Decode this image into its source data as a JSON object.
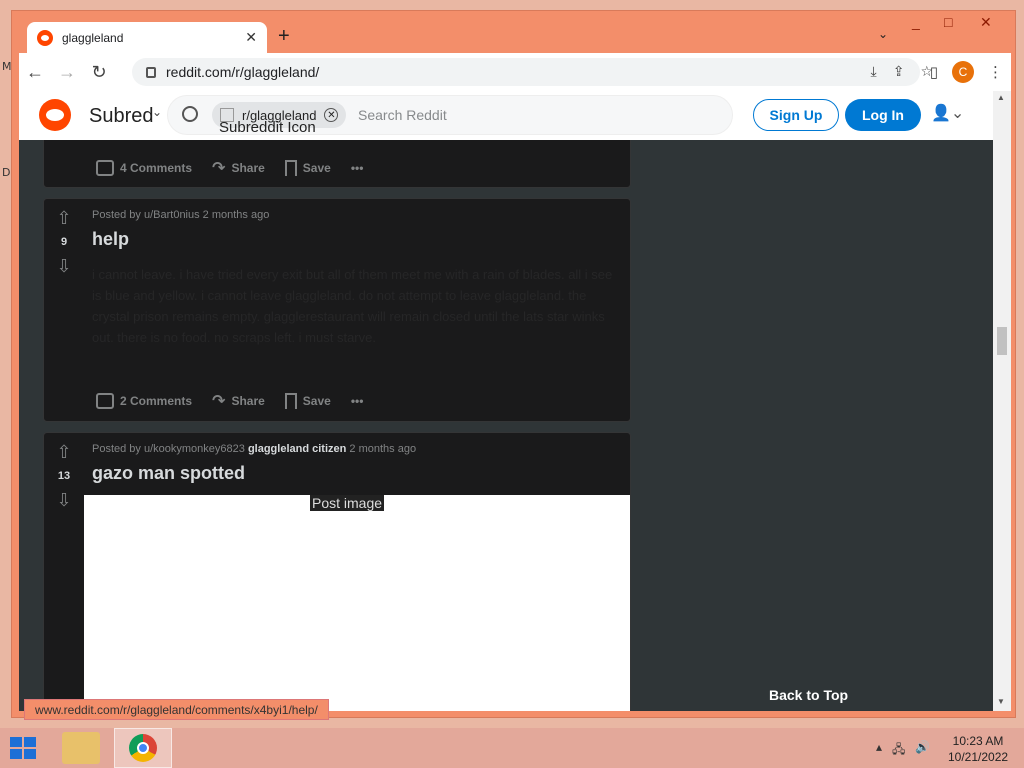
{
  "desktop": {
    "marks": [
      "M",
      "D"
    ]
  },
  "browser": {
    "tab_title": "glaggleland",
    "tab_close": "✕",
    "new_tab": "+",
    "url": "reddit.com/r/glaggleland/",
    "status_url": "www.reddit.com/r/glaggleland/comments/x4byi1/help/",
    "window_buttons": [
      "_",
      "□",
      "✕"
    ],
    "profile_initial": "C"
  },
  "reddit": {
    "subreddit_img_alt": "Subreddit Icon",
    "search_chip": "r/glaggleland",
    "search_placeholder": "Search Reddit",
    "signup": "Sign Up",
    "login": "Log In",
    "back_to_top": "Back to Top"
  },
  "posts": [
    {
      "comments": "4 Comments",
      "share": "Share",
      "save": "Save"
    },
    {
      "score": "9",
      "meta": "Posted by u/Bart0nius 2 months ago",
      "title": "help",
      "text": "i cannot leave. i have tried every exit but all of them meet me with a rain of blades. all i see is blue and yellow. i cannot leave glaggleland. do not attempt to leave glaggleland. the crystal prison remains empty. glagglerestaurant will remain closed until the lats star winks out. there is no food. no scraps left. i must starve.",
      "comments": "2 Comments",
      "share": "Share",
      "save": "Save"
    },
    {
      "score": "13",
      "meta_prefix": "Posted by u/kookymonkey6823",
      "flair": "glaggleland citizen",
      "meta_suffix": "2 months ago",
      "title": "gazo man spotted",
      "image_alt": "Post image"
    }
  ],
  "taskbar": {
    "time": "10:23 AM",
    "date": "10/21/2022"
  }
}
